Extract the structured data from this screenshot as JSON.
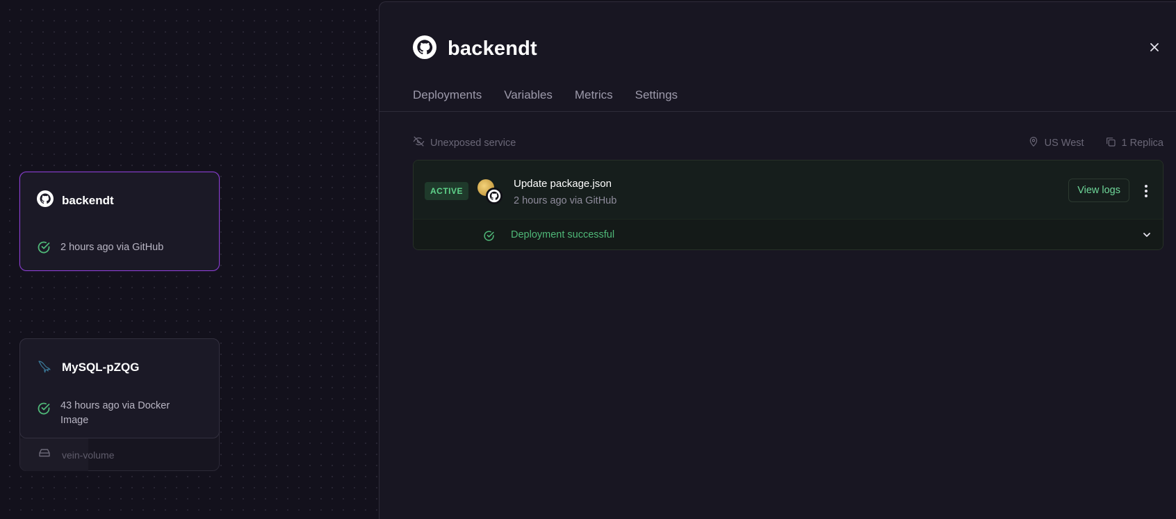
{
  "canvas": {
    "services": [
      {
        "name": "backendt",
        "icon": "github-icon",
        "status_text": "2 hours ago via GitHub",
        "selected": true
      },
      {
        "name": "MySQL-pZQG",
        "icon": "mysql-dolphin-icon",
        "status_text": "43 hours ago via Docker Image",
        "volume": "vein-volume"
      }
    ]
  },
  "panel": {
    "title": "backendt",
    "tabs": [
      "Deployments",
      "Variables",
      "Metrics",
      "Settings"
    ],
    "exposure": "Unexposed service",
    "region": "US West",
    "replicas": "1 Replica",
    "deployment": {
      "badge": "ACTIVE",
      "commit_message": "Update package.json",
      "commit_meta": "2 hours ago via GitHub",
      "view_logs_label": "View logs",
      "status": "Deployment successful"
    }
  },
  "colors": {
    "accent_selected": "#8a3fd1",
    "success": "#4fb878",
    "background": "#13111c"
  }
}
